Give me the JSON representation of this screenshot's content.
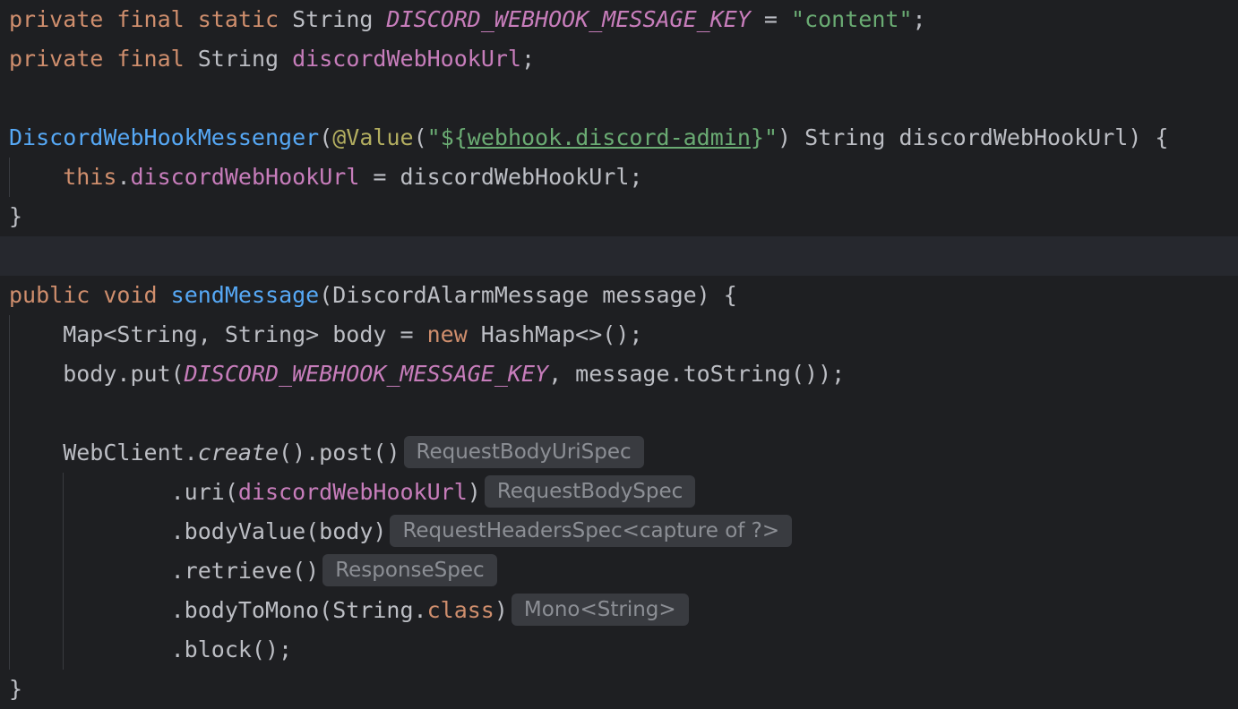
{
  "editor": {
    "lines": [
      {
        "name": "line-1",
        "tokens": [
          {
            "t": "private",
            "c": "kw"
          },
          {
            "t": " ",
            "c": "plain"
          },
          {
            "t": "final",
            "c": "kw"
          },
          {
            "t": " ",
            "c": "plain"
          },
          {
            "t": "static",
            "c": "kw"
          },
          {
            "t": " String ",
            "c": "plain"
          },
          {
            "t": "DISCORD_WEBHOOK_MESSAGE_KEY",
            "c": "const"
          },
          {
            "t": " = ",
            "c": "plain"
          },
          {
            "t": "\"content\"",
            "c": "str"
          },
          {
            "t": ";",
            "c": "plain"
          }
        ]
      },
      {
        "name": "line-2",
        "tokens": [
          {
            "t": "private",
            "c": "kw"
          },
          {
            "t": " ",
            "c": "plain"
          },
          {
            "t": "final",
            "c": "kw"
          },
          {
            "t": " String ",
            "c": "plain"
          },
          {
            "t": "discordWebHookUrl",
            "c": "field"
          },
          {
            "t": ";",
            "c": "plain"
          }
        ]
      },
      {
        "name": "line-3",
        "tokens": []
      },
      {
        "name": "line-4",
        "tokens": [
          {
            "t": "DiscordWebHookMessenger",
            "c": "fn"
          },
          {
            "t": "(",
            "c": "plain"
          },
          {
            "t": "@Value",
            "c": "ann"
          },
          {
            "t": "(",
            "c": "plain"
          },
          {
            "t": "\"",
            "c": "str"
          },
          {
            "t": "${",
            "c": "str"
          },
          {
            "t": "webhook.discord-admin",
            "c": "tpl"
          },
          {
            "t": "}",
            "c": "str"
          },
          {
            "t": "\"",
            "c": "str"
          },
          {
            "t": ") String discordWebHookUrl) {",
            "c": "plain"
          }
        ]
      },
      {
        "name": "line-5",
        "tokens": [
          {
            "t": "    ",
            "c": "plain"
          },
          {
            "t": "this",
            "c": "kw"
          },
          {
            "t": ".",
            "c": "plain"
          },
          {
            "t": "discordWebHookUrl",
            "c": "field"
          },
          {
            "t": " = discordWebHookUrl;",
            "c": "plain"
          }
        ]
      },
      {
        "name": "line-6",
        "tokens": [
          {
            "t": "}",
            "c": "plain"
          }
        ]
      },
      {
        "name": "line-7",
        "current": true,
        "tokens": []
      },
      {
        "name": "line-8",
        "tokens": [
          {
            "t": "public",
            "c": "kw"
          },
          {
            "t": " ",
            "c": "plain"
          },
          {
            "t": "void",
            "c": "kw"
          },
          {
            "t": " ",
            "c": "plain"
          },
          {
            "t": "sendMessage",
            "c": "fn"
          },
          {
            "t": "(DiscordAlarmMessage message) {",
            "c": "plain"
          }
        ]
      },
      {
        "name": "line-9",
        "tokens": [
          {
            "t": "    Map<String, String> body = ",
            "c": "plain"
          },
          {
            "t": "new",
            "c": "kw"
          },
          {
            "t": " HashMap<>();",
            "c": "plain"
          }
        ]
      },
      {
        "name": "line-10",
        "tokens": [
          {
            "t": "    body.put(",
            "c": "plain"
          },
          {
            "t": "DISCORD_WEBHOOK_MESSAGE_KEY",
            "c": "const"
          },
          {
            "t": ", message.toString());",
            "c": "plain"
          }
        ]
      },
      {
        "name": "line-11",
        "tokens": []
      },
      {
        "name": "line-12",
        "tokens": [
          {
            "t": "    WebClient.",
            "c": "plain"
          },
          {
            "t": "create",
            "c": "plain italic"
          },
          {
            "t": "().post()",
            "c": "plain"
          }
        ],
        "hint": "RequestBodyUriSpec"
      },
      {
        "name": "line-13",
        "tokens": [
          {
            "t": "            .uri(",
            "c": "plain"
          },
          {
            "t": "discordWebHookUrl",
            "c": "field"
          },
          {
            "t": ")",
            "c": "plain"
          }
        ],
        "hint": "RequestBodySpec"
      },
      {
        "name": "line-14",
        "tokens": [
          {
            "t": "            .bodyValue(body)",
            "c": "plain"
          }
        ],
        "hint": "RequestHeadersSpec<capture of ?>"
      },
      {
        "name": "line-15",
        "tokens": [
          {
            "t": "            .retrieve()",
            "c": "plain"
          }
        ],
        "hint": "ResponseSpec"
      },
      {
        "name": "line-16",
        "tokens": [
          {
            "t": "            .bodyToMono(String.",
            "c": "plain"
          },
          {
            "t": "class",
            "c": "kw"
          },
          {
            "t": ")",
            "c": "plain"
          }
        ],
        "hint": "Mono<String>"
      },
      {
        "name": "line-17",
        "tokens": [
          {
            "t": "            .block();",
            "c": "plain"
          }
        ]
      },
      {
        "name": "line-18",
        "tokens": [
          {
            "t": "}",
            "c": "plain"
          }
        ]
      }
    ]
  }
}
